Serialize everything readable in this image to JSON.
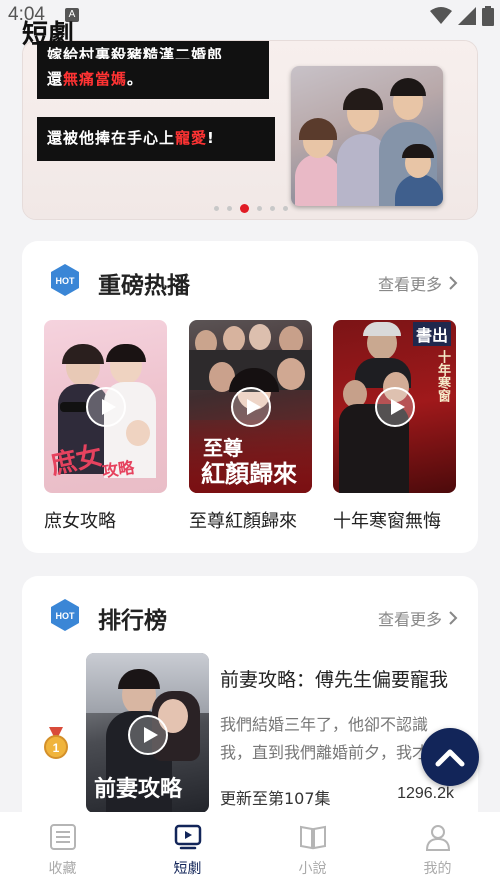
{
  "status": {
    "time": "4:04",
    "notif_letter": "A"
  },
  "app": {
    "title": "短劇"
  },
  "banner": {
    "caption1_white": "還",
    "caption1_red": "無痛當媽",
    "caption1_end": "。",
    "caption1_top_clip": "嫁給村裏殺豬糙漢二婚郎",
    "caption2_white": "還被他捧在手心上",
    "caption2_red": "寵愛",
    "caption2_end": "!",
    "dot_count": 6,
    "active_dot": 2
  },
  "hot_section": {
    "badge": "HOT",
    "title": "重磅热播",
    "more": "查看更多",
    "videos": [
      {
        "title": "庶女攻略"
      },
      {
        "title": "至尊紅顏歸來"
      },
      {
        "title": "十年寒窗無悔"
      }
    ]
  },
  "rank_section": {
    "badge": "HOT",
    "title": "排行榜",
    "more": "查看更多",
    "items": [
      {
        "rank": "1",
        "title": "前妻攻略：傅先生偏要寵我",
        "desc": "我們結婚三年了，他卻不認識我，直到我們離婚前夕，我才",
        "episode": "更新至第107集",
        "views": "1296.2k",
        "poster_text": "前妻攻略"
      }
    ]
  },
  "nav": {
    "items": [
      {
        "label": "收藏",
        "icon": "list-icon"
      },
      {
        "label": "短劇",
        "icon": "play-screen-icon"
      },
      {
        "label": "小說",
        "icon": "book-icon"
      },
      {
        "label": "我的",
        "icon": "person-icon"
      }
    ],
    "active": 1
  },
  "colors": {
    "accent": "#122559",
    "red": "#e01b24",
    "badge": "#3a86d6"
  }
}
